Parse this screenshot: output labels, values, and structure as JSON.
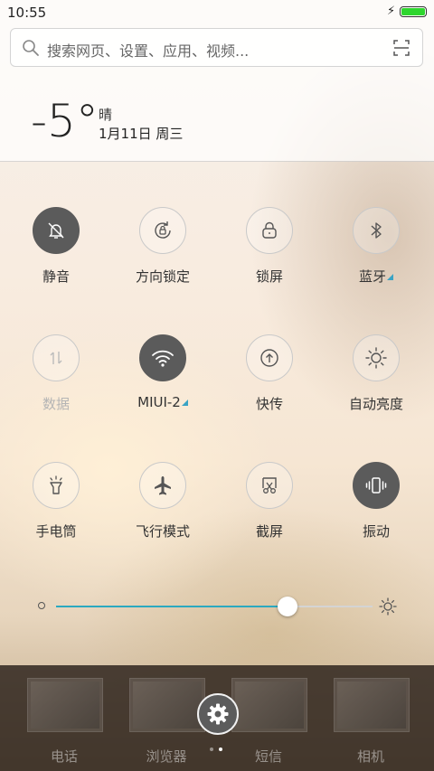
{
  "status_bar": {
    "time": "10:55"
  },
  "search": {
    "placeholder": "搜索网页、设置、应用、视频..."
  },
  "weather": {
    "temperature": "-5°",
    "condition": "晴",
    "date": "1月11日 周三"
  },
  "toggles": [
    {
      "label": "静音",
      "icon": "bell-off-icon",
      "active": true
    },
    {
      "label": "方向锁定",
      "icon": "rotation-lock-icon",
      "active": false
    },
    {
      "label": "锁屏",
      "icon": "lock-icon",
      "active": false
    },
    {
      "label": "蓝牙",
      "icon": "bluetooth-icon",
      "active": false,
      "has_more": true
    },
    {
      "label": "数据",
      "icon": "mobile-data-icon",
      "active": false,
      "disabled": true
    },
    {
      "label": "MIUI-2",
      "icon": "wifi-icon",
      "active": true,
      "has_more": true
    },
    {
      "label": "快传",
      "icon": "quick-transfer-icon",
      "active": false
    },
    {
      "label": "自动亮度",
      "icon": "auto-brightness-icon",
      "active": false
    },
    {
      "label": "手电筒",
      "icon": "flashlight-icon",
      "active": false
    },
    {
      "label": "飞行模式",
      "icon": "airplane-icon",
      "active": false
    },
    {
      "label": "截屏",
      "icon": "screenshot-icon",
      "active": false
    },
    {
      "label": "振动",
      "icon": "vibrate-icon",
      "active": true
    }
  ],
  "brightness": {
    "level": 0.73
  },
  "dock": {
    "apps": [
      {
        "name": "电话"
      },
      {
        "name": "浏览器"
      },
      {
        "name": "短信"
      },
      {
        "name": "相机"
      }
    ]
  },
  "colors": {
    "accent": "#2ba9c0",
    "active_toggle": "#5b5b5b",
    "battery": "#2ed62e",
    "more_indicator": "#3aa3c4"
  }
}
